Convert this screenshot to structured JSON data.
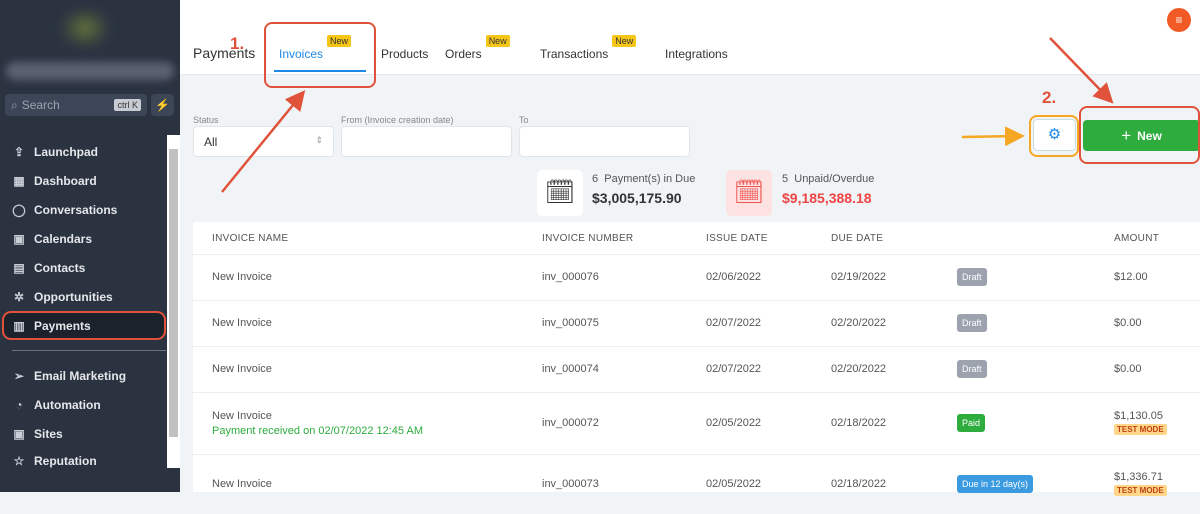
{
  "sidebar": {
    "search_placeholder": "Search",
    "search_shortcut": "ctrl K",
    "items": [
      {
        "label": "Launchpad",
        "icon": "⇪"
      },
      {
        "label": "Dashboard",
        "icon": "▦"
      },
      {
        "label": "Conversations",
        "icon": "◯"
      },
      {
        "label": "Calendars",
        "icon": "▣"
      },
      {
        "label": "Contacts",
        "icon": "▤"
      },
      {
        "label": "Opportunities",
        "icon": "✲"
      },
      {
        "label": "Payments",
        "icon": "▥"
      }
    ],
    "items2": [
      {
        "label": "Email Marketing",
        "icon": "➢"
      },
      {
        "label": "Automation",
        "icon": "◔"
      },
      {
        "label": "Sites",
        "icon": "▣"
      },
      {
        "label": "Reputation",
        "icon": "☆"
      }
    ]
  },
  "header": {
    "title": "Payments",
    "tabs": [
      {
        "label": "Invoices",
        "badge": "New"
      },
      {
        "label": "Products"
      },
      {
        "label": "Orders",
        "badge": "New"
      },
      {
        "label": "Transactions",
        "badge": "New"
      },
      {
        "label": "Integrations"
      }
    ]
  },
  "filters": {
    "status_label": "Status",
    "status_value": "All",
    "from_label": "From (Invoice creation date)",
    "to_label": "To"
  },
  "actions": {
    "new_label": "New"
  },
  "stats": {
    "due_count": "6",
    "due_label": "Payment(s) in Due",
    "due_amount": "$3,005,175.90",
    "overdue_count": "5",
    "overdue_label": "Unpaid/Overdue",
    "overdue_amount": "$9,185,388.18"
  },
  "table": {
    "headers": [
      "INVOICE NAME",
      "INVOICE NUMBER",
      "ISSUE DATE",
      "DUE DATE",
      "AMOUNT"
    ],
    "rows": [
      {
        "name": "New Invoice",
        "number": "inv_000076",
        "issue": "02/06/2022",
        "due": "02/19/2022",
        "status": "Draft",
        "amount": "$12.00"
      },
      {
        "name": "New Invoice",
        "number": "inv_000075",
        "issue": "02/07/2022",
        "due": "02/20/2022",
        "status": "Draft",
        "amount": "$0.00"
      },
      {
        "name": "New Invoice",
        "number": "inv_000074",
        "issue": "02/07/2022",
        "due": "02/20/2022",
        "status": "Draft",
        "amount": "$0.00"
      },
      {
        "name": "New Invoice",
        "sub": "Payment received on 02/07/2022 12:45 AM",
        "number": "inv_000072",
        "issue": "02/05/2022",
        "due": "02/18/2022",
        "status": "Paid",
        "amount": "$1,130.05",
        "tag": "TEST MODE"
      },
      {
        "name": "New Invoice",
        "number": "inv_000073",
        "issue": "02/05/2022",
        "due": "02/18/2022",
        "status": "Due in 12 day(s)",
        "amount": "$1,336.71",
        "tag": "TEST MODE"
      }
    ]
  },
  "annotations": {
    "step1": "1.",
    "step2": "2."
  },
  "colors": {
    "accent": "#1e88e5",
    "new_button": "#2eac3e",
    "annotation": "#e0523a",
    "draft": "#9ca3af",
    "paid": "#2eac3e",
    "due": "#3b9be0"
  }
}
